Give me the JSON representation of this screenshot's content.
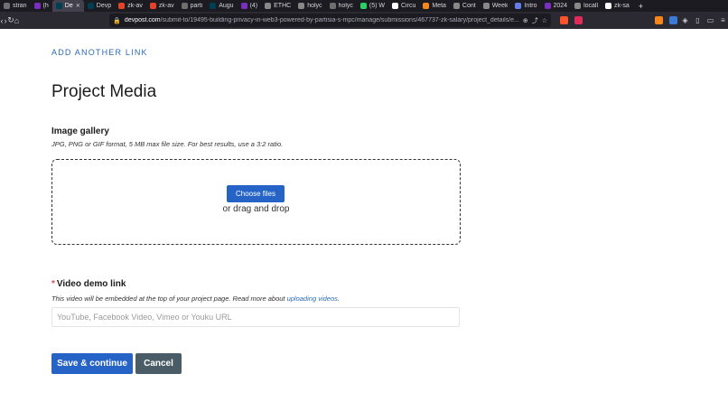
{
  "browser": {
    "tabs": [
      {
        "label": "stran",
        "color": "#6f6f78"
      },
      {
        "label": "(h",
        "color": "#7b2fbf"
      },
      {
        "label": "De",
        "color": "#003e54",
        "active": true
      },
      {
        "label": "Devp",
        "color": "#003e54"
      },
      {
        "label": "zk-av",
        "color": "#e24329"
      },
      {
        "label": "zk-av",
        "color": "#e24329"
      },
      {
        "label": "parti",
        "color": "#6e6e6e"
      },
      {
        "label": "Augu",
        "color": "#003e54"
      },
      {
        "label": "(4)",
        "color": "#7b2fbf"
      },
      {
        "label": "ETHC",
        "color": "#888888"
      },
      {
        "label": "holyc",
        "color": "#888888"
      },
      {
        "label": "holyc",
        "color": "#6e6e6e"
      },
      {
        "label": "(5) W",
        "color": "#25d366"
      },
      {
        "label": "Circu",
        "color": "#ffffff"
      },
      {
        "label": "Meta",
        "color": "#f6851b"
      },
      {
        "label": "Cont",
        "color": "#888888"
      },
      {
        "label": "Week",
        "color": "#888888"
      },
      {
        "label": "Intro",
        "color": "#627eea"
      },
      {
        "label": "2024",
        "color": "#7b2fbf"
      },
      {
        "label": "locall",
        "color": "#888888"
      },
      {
        "label": "zk-sa",
        "color": "#ffffff"
      }
    ],
    "url_domain": "devpost.com",
    "url_path": "/submit-to/19495-building-privacy-in-web3-powered-by-partisia-s-mpc/manage/submissions/467737-zk-salary/project_details/e..."
  },
  "page": {
    "add_link": "ADD ANOTHER LINK",
    "section_title": "Project Media",
    "gallery": {
      "label": "Image gallery",
      "help": "JPG, PNG or GIF format, 5 MB max file size. For best results, use a 3:2 ratio.",
      "choose_button": "Choose files",
      "drag_text": "or drag and drop"
    },
    "video": {
      "required_marker": "*",
      "label": "Video demo link",
      "help_prefix": "This video will be embedded at the top of your project page. Read more about ",
      "help_link": "uploading videos",
      "help_suffix": ".",
      "placeholder": "YouTube, Facebook Video, Vimeo or Youku URL",
      "value": ""
    },
    "save_button": "Save & continue",
    "cancel_button": "Cancel"
  }
}
